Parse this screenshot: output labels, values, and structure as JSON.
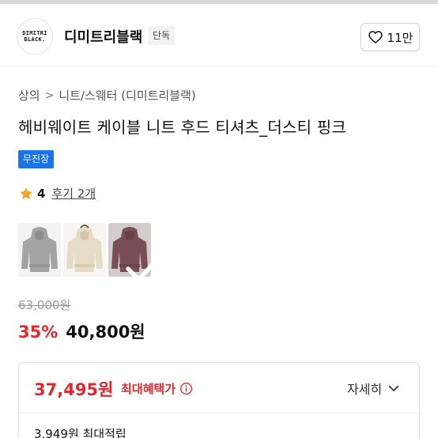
{
  "brand": {
    "logo_text": [
      "DIMITRI",
      "BLACK."
    ],
    "name": "디미트리블랙",
    "exclusive_label": "단독",
    "like_count": "11만"
  },
  "breadcrumb": {
    "category": "상의",
    "separator": ">",
    "subcategory": "니트/스웨터 (디미트리블랙)"
  },
  "product": {
    "title": "헤비웨이트 케이블 니트 후드 티셔츠_더스티 핑크",
    "shipping_badge": "무진장",
    "rating": "4",
    "review_label": "후기 2개",
    "variants": [
      {
        "name": "grey",
        "color": "#a3a3a3",
        "selected": false
      },
      {
        "name": "cream",
        "color": "#e6dcc6",
        "selected": false
      },
      {
        "name": "dusty-pink",
        "color": "#8a5a61",
        "selected": true
      }
    ]
  },
  "pricing": {
    "original": "63,000원",
    "discount": "35%",
    "sale": "40,800원",
    "best_price": "37,495원",
    "best_label": "최대혜택가",
    "detail_toggle": "자세히",
    "points": "3,949원 최대적립"
  },
  "colors": {
    "accent_red": "#e0282e",
    "badge_blue": "#1a73e8",
    "star": "#f5a623"
  }
}
